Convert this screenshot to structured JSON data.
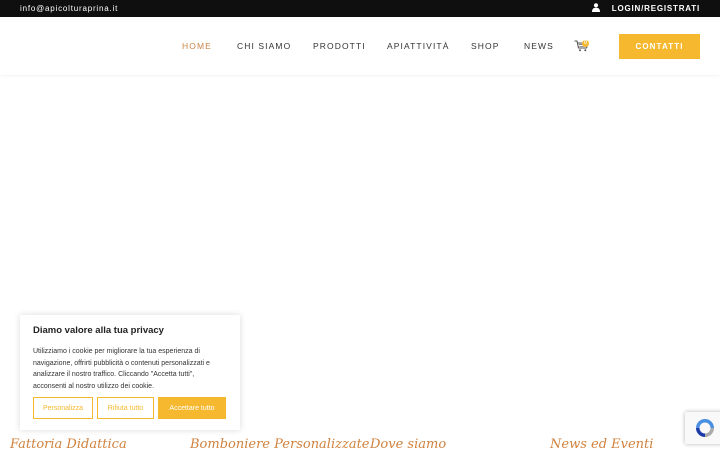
{
  "topbar": {
    "email": "info@apicolturaprina.it",
    "login_label": "LOGIN/REGISTRATI"
  },
  "nav": {
    "items": [
      {
        "label": "HOME",
        "active": true
      },
      {
        "label": "CHI SIAMO"
      },
      {
        "label": "PRODOTTI"
      },
      {
        "label": "APIATTIVITÀ"
      },
      {
        "label": "SHOP"
      },
      {
        "label": "NEWS"
      }
    ],
    "cart_count": "0",
    "contact_label": "CONTATTI"
  },
  "footer_sections": [
    "Fattoria Didattica",
    "Bomboniere Personalizzate",
    "Dove siamo",
    "News ed Eventi"
  ],
  "cookie_banner": {
    "title": "Diamo valore alla tua privacy",
    "text": "Utilizziamo i cookie per migliorare la tua esperienza di navigazione, offrirti pubblicità o contenuti personalizzati e analizzare il nostro traffico. Cliccando \"Accetta tutti\", acconsenti al nostro utilizzo dei cookie.",
    "customize_label": "Personalizza",
    "reject_label": "Rifiuta tutto",
    "accept_label": "Accettare tutto"
  },
  "colors": {
    "accent": "#f5b82e",
    "active_nav": "#c8854a",
    "heading": "#d0823e",
    "topbar_bg": "#0f0f0f"
  },
  "icons": {
    "user": "user-icon",
    "cart": "cart-icon",
    "recaptcha": "recaptcha-icon"
  }
}
